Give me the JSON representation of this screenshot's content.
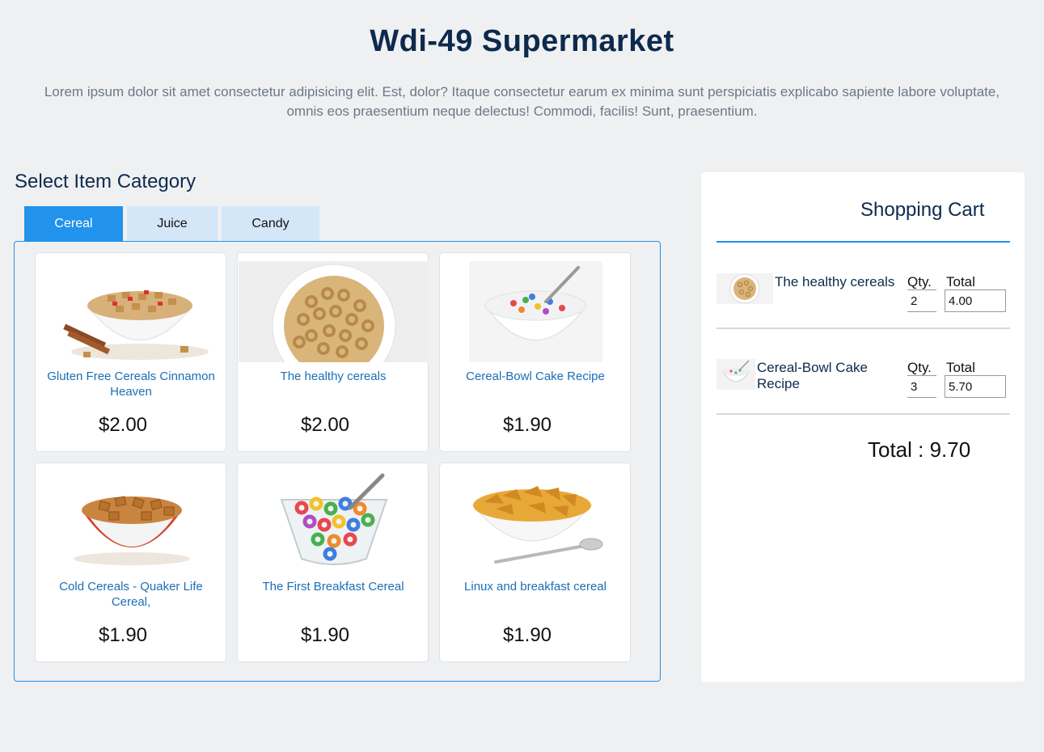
{
  "header": {
    "title": "Wdi-49 Supermarket",
    "intro": "Lorem ipsum dolor sit amet consectetur adipisicing elit. Est, dolor? Itaque consectetur earum ex minima sunt perspiciatis explicabo sapiente labore voluptate, omnis eos praesentium neque delectus! Commodi, facilis! Sunt, praesentium."
  },
  "category": {
    "title": "Select Item Category",
    "tabs": [
      {
        "label": "Cereal",
        "active": true
      },
      {
        "label": "Juice",
        "active": false
      },
      {
        "label": "Candy",
        "active": false
      }
    ]
  },
  "products": [
    {
      "name": "Gluten Free Cereals Cinnamon Heaven",
      "price": "$2.00",
      "image": "cereal-bowl-cinnamon-image"
    },
    {
      "name": "The healthy cereals",
      "price": "$2.00",
      "image": "cereal-bowl-oats-image"
    },
    {
      "name": "Cereal-Bowl Cake Recipe",
      "price": "$1.90",
      "image": "cereal-bowl-milk-image"
    },
    {
      "name": "Cold Cereals - Quaker Life Cereal,",
      "price": "$1.90",
      "image": "cereal-bowl-squares-image"
    },
    {
      "name": "The First Breakfast Cereal",
      "price": "$1.90",
      "image": "cereal-bowl-loops-image"
    },
    {
      "name": "Linux and breakfast cereal",
      "price": "$1.90",
      "image": "cereal-bowl-flakes-image"
    }
  ],
  "cart": {
    "title": "Shopping Cart",
    "qty_label": "Qty.",
    "total_label": "Total",
    "items": [
      {
        "name": "The healthy cereals",
        "qty": "2",
        "total": "4.00"
      },
      {
        "name": "Cereal-Bowl Cake Recipe",
        "qty": "3",
        "total": "5.70"
      }
    ],
    "grand_total": "Total : 9.70"
  },
  "colors": {
    "accent": "#2193ec",
    "tab_inactive": "#d4e7f8",
    "title": "#0d2a4d",
    "product_name": "#1b6fb5",
    "background": "#eff0f2"
  }
}
